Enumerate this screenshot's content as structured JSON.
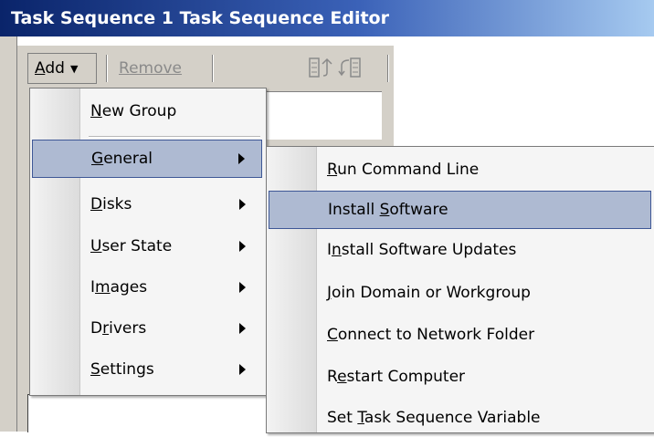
{
  "window": {
    "title": "Task Sequence 1 Task Sequence Editor"
  },
  "toolbar": {
    "add_label": "Add",
    "add_mnemonic": "A",
    "remove_label": "Remove",
    "remove_mnemonic": "R",
    "icons": [
      "move-up-icon",
      "move-down-icon"
    ]
  },
  "add_menu": {
    "items": [
      {
        "pre": "",
        "key": "N",
        "post": "ew Group",
        "submenu": false
      },
      {
        "pre": "",
        "key": "G",
        "post": "eneral",
        "submenu": true,
        "highlighted": true
      },
      {
        "pre": "",
        "key": "D",
        "post": "isks",
        "submenu": true
      },
      {
        "pre": "",
        "key": "U",
        "post": "ser State",
        "submenu": true
      },
      {
        "pre": "I",
        "key": "m",
        "post": "ages",
        "submenu": true
      },
      {
        "pre": "D",
        "key": "r",
        "post": "ivers",
        "submenu": true
      },
      {
        "pre": "",
        "key": "S",
        "post": "ettings",
        "submenu": true
      }
    ]
  },
  "general_submenu": {
    "items": [
      {
        "pre": "",
        "key": "R",
        "post": "un Command Line"
      },
      {
        "pre": "Install ",
        "key": "S",
        "post": "oftware",
        "highlighted": true
      },
      {
        "pre": "I",
        "key": "n",
        "post": "stall Software Updates"
      },
      {
        "pre": "",
        "key": "J",
        "post": "oin Domain or Workgroup"
      },
      {
        "pre": "",
        "key": "C",
        "post": "onnect to Network Folder"
      },
      {
        "pre": "R",
        "key": "e",
        "post": "start Computer"
      },
      {
        "pre": "Set ",
        "key": "T",
        "post": "ask Sequence Variable"
      }
    ]
  }
}
